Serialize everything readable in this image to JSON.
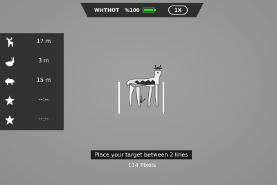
{
  "status": {
    "mode": "WHTHOT",
    "battery_text": "%100",
    "battery_level": 1.0,
    "zoom": "1X"
  },
  "presets": [
    {
      "icon": "deer-icon",
      "value": "17 m"
    },
    {
      "icon": "rabbit-icon",
      "value": "3 m"
    },
    {
      "icon": "boar-icon",
      "value": "15 m"
    },
    {
      "icon": "star-icon",
      "value": "--:--"
    },
    {
      "icon": "star-icon",
      "value": "--:--"
    }
  ],
  "message": "Place your target between 2 lines",
  "pixels": "114 Pixels",
  "colors": {
    "battery": "#3fd23f",
    "panel": "#323232",
    "background": "#979797"
  }
}
